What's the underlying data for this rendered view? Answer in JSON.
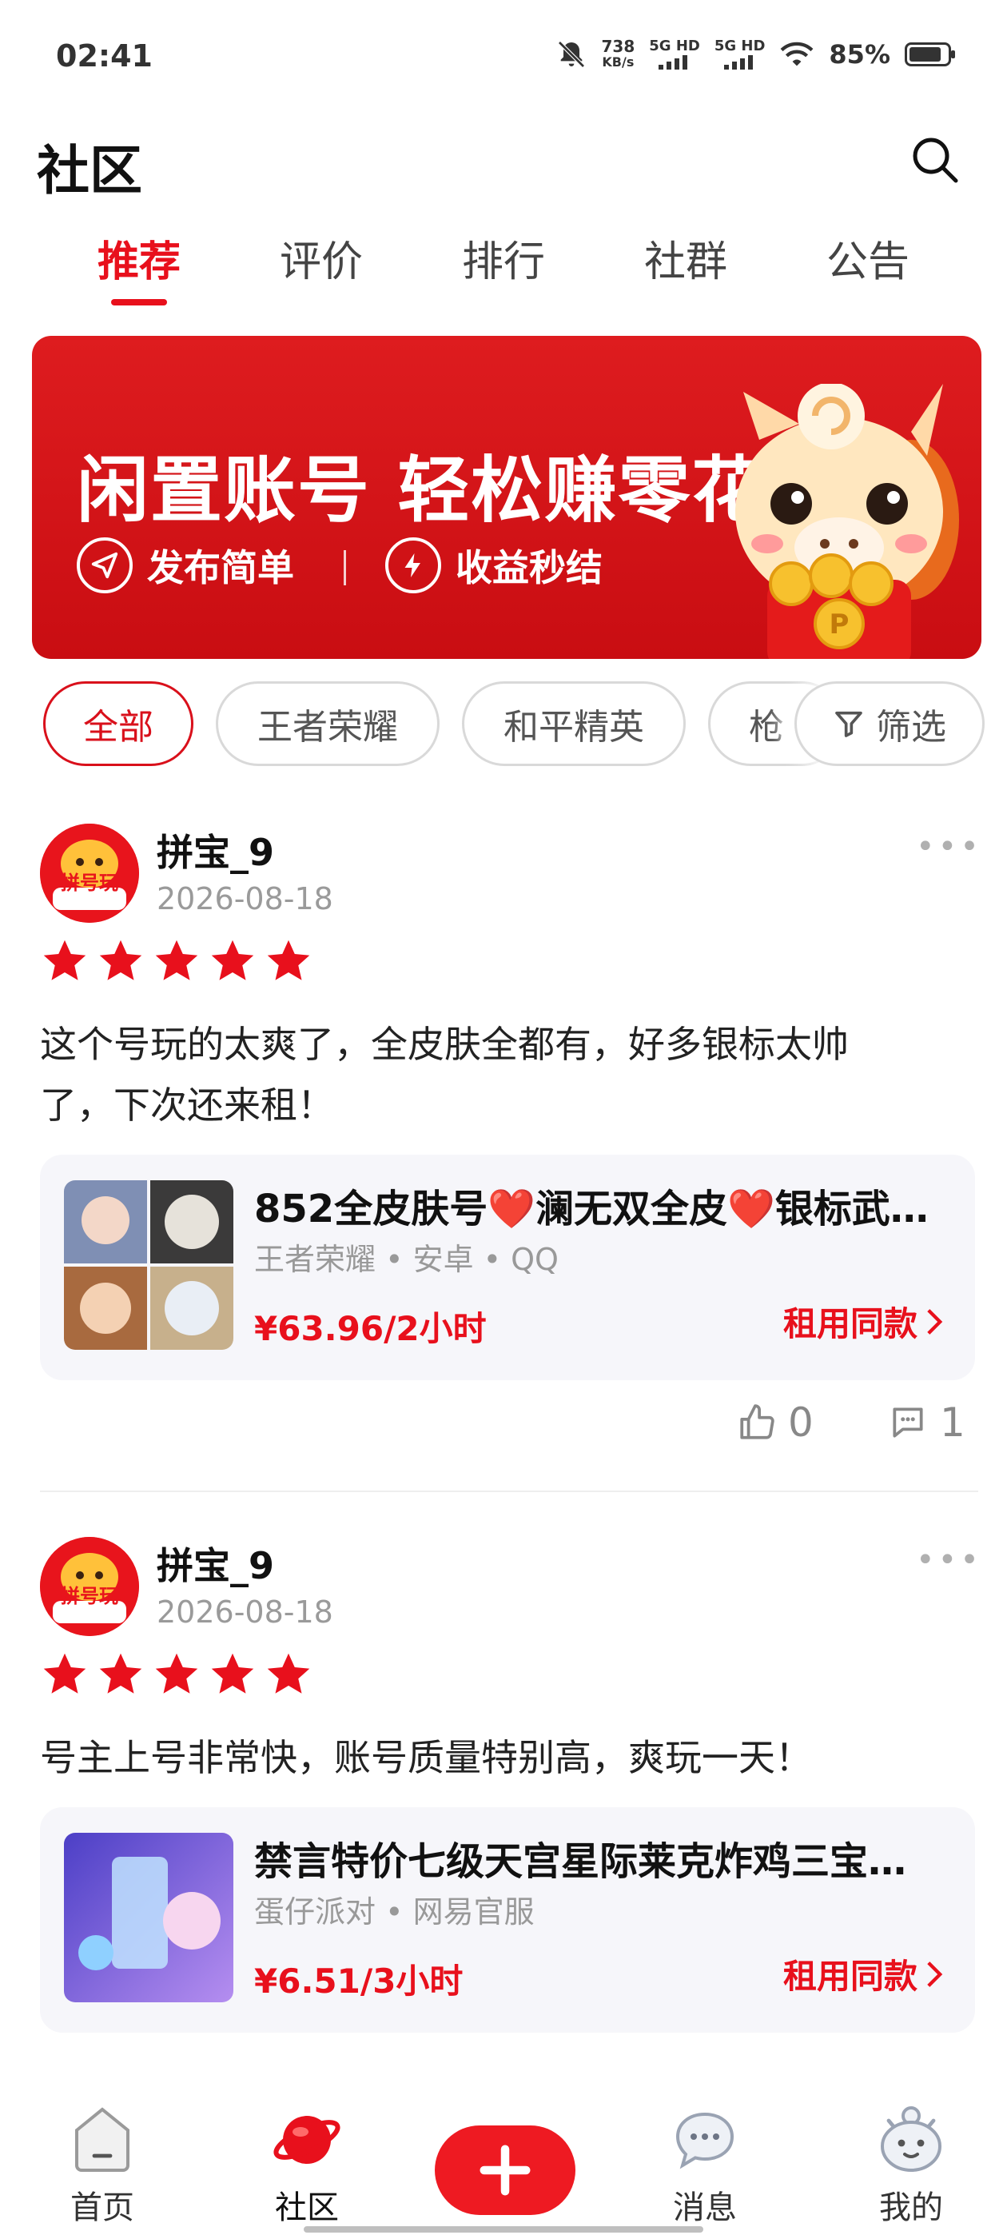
{
  "status_bar": {
    "time": "02:41",
    "speed_value": "738",
    "speed_unit": "KB/s",
    "network_1": "5G HD",
    "network_2": "5G HD",
    "battery_percent": "85%",
    "battery_level": 0.85
  },
  "header": {
    "title": "社区",
    "search_icon": "search-icon"
  },
  "tabs": [
    {
      "label": "推荐",
      "active": true
    },
    {
      "label": "评价",
      "active": false
    },
    {
      "label": "排行",
      "active": false
    },
    {
      "label": "社群",
      "active": false
    },
    {
      "label": "公告",
      "active": false
    }
  ],
  "banner": {
    "headline": "闲置账号 轻松赚零花",
    "feature_1": "发布简单",
    "feature_2": "收益秒结",
    "colors": {
      "background": "#d4151a"
    }
  },
  "filter_chips": [
    {
      "label": "全部",
      "active": true
    },
    {
      "label": "王者荣耀",
      "active": false
    },
    {
      "label": "和平精英",
      "active": false
    },
    {
      "label": "枪",
      "active": false
    }
  ],
  "filter_button": {
    "label": "筛选",
    "icon": "filter-icon"
  },
  "posts": [
    {
      "username": "拼宝_9",
      "avatar_text": "拼号玩",
      "date": "2026-08-18",
      "rating": 5,
      "text": "这个号玩的太爽了，全皮肤全都有，好多银标太帅了，下次还来租！",
      "product": {
        "title": "852全皮肤号❤️澜无双全皮❤️银标武…",
        "meta": "王者荣耀 • 安卓 • QQ",
        "price": "¥63.96/2小时",
        "rent_label": "租用同款"
      },
      "likes": "0",
      "comments": "1"
    },
    {
      "username": "拼宝_9",
      "avatar_text": "拼号玩",
      "date": "2026-08-18",
      "rating": 5,
      "text": "号主上号非常快，账号质量特别高，爽玩一天！",
      "product": {
        "title": "禁言特价七级天宫星际莱克炸鸡三宝…",
        "meta": "蛋仔派对 • 网易官服",
        "price": "¥6.51/3小时",
        "rent_label": "租用同款"
      }
    }
  ],
  "bottom_nav": [
    {
      "label": "首页",
      "icon": "home-icon"
    },
    {
      "label": "社区",
      "icon": "planet-icon",
      "active": true
    },
    {
      "label": "",
      "icon": "plus-icon"
    },
    {
      "label": "消息",
      "icon": "chat-bubble-icon"
    },
    {
      "label": "我的",
      "icon": "mascot-face-icon"
    }
  ],
  "colors": {
    "accent": "#e8101c",
    "star": "#e8101c"
  }
}
